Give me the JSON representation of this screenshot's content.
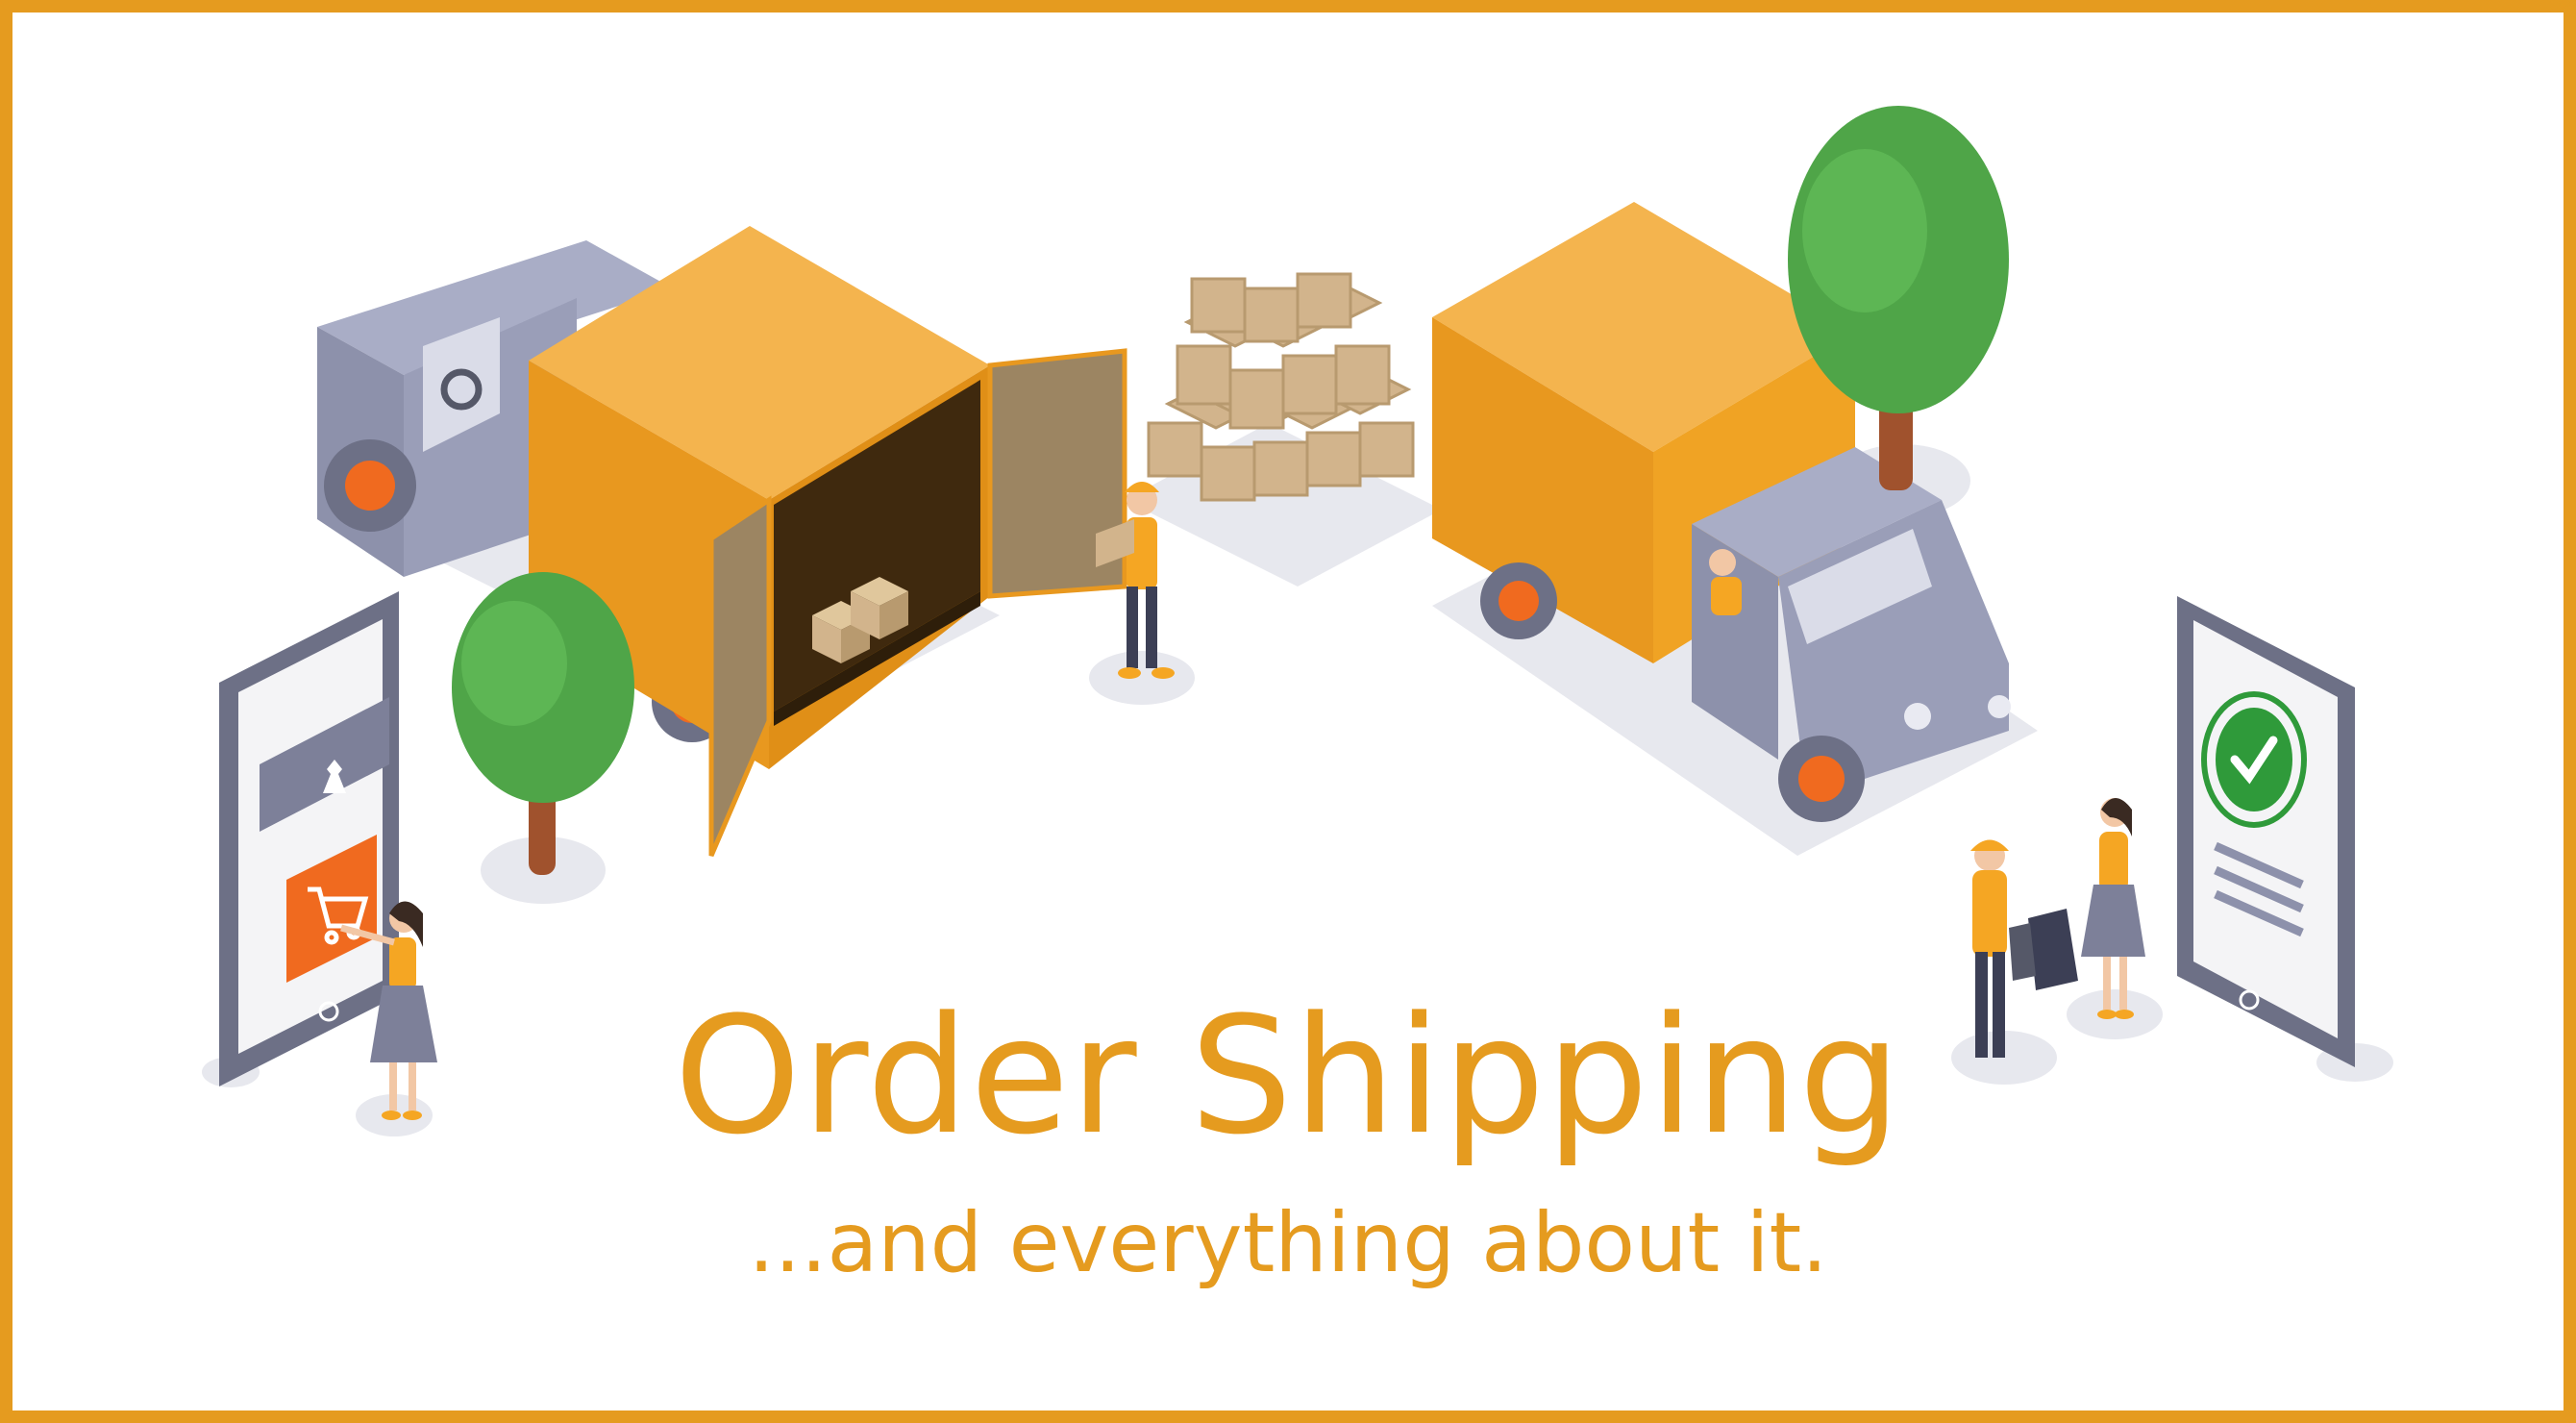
{
  "banner": {
    "title": "Order Shipping",
    "subtitle": "...and everything about it."
  },
  "colors": {
    "accent": "#E59B1F",
    "border": "#E59B1F",
    "truck_body": "#9A9EB8",
    "cargo_box": "#E8981F",
    "tree": "#4FA548",
    "parcel": "#D2B48C",
    "highlight": "#F06A1F",
    "confirm": "#2F9A3A"
  },
  "icons": {
    "left_phone_product": "dress-icon",
    "left_phone_action": "shopping-cart-icon",
    "right_phone_status": "checkmark-icon"
  }
}
